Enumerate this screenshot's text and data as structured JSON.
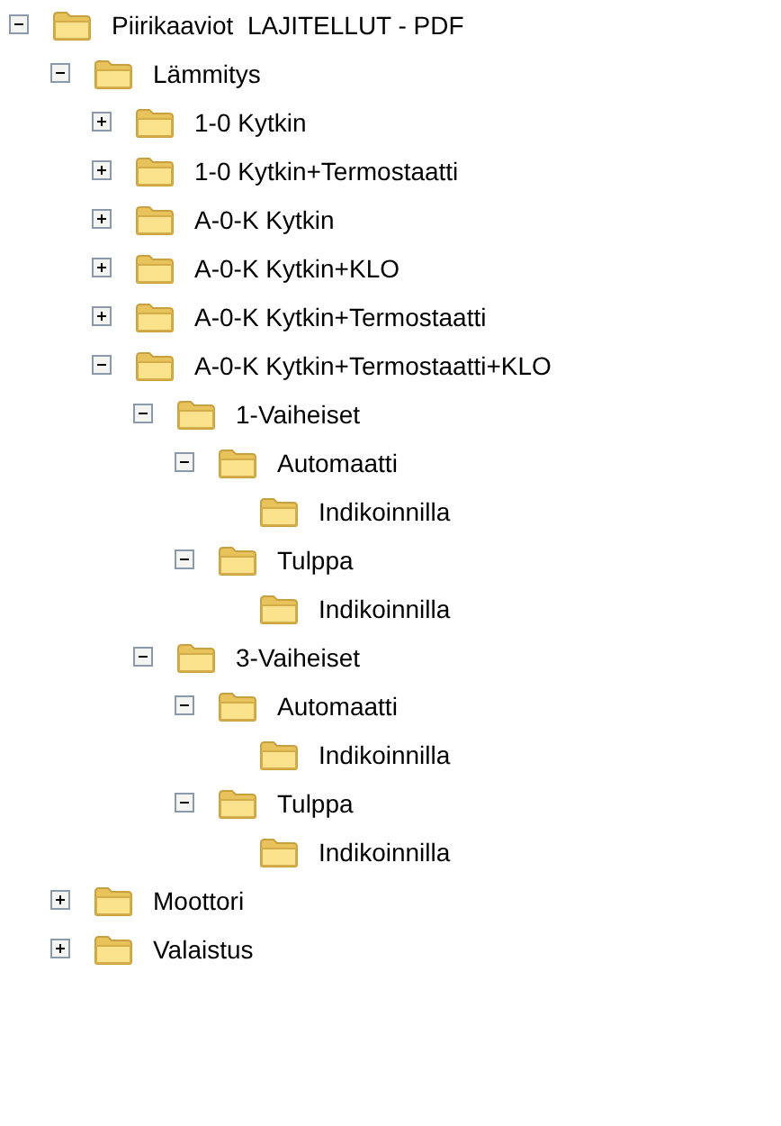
{
  "tree": [
    {
      "label": "Piirikaaviot  LAJITELLUT - PDF",
      "expanded": true,
      "children": [
        {
          "label": "Lämmitys",
          "expanded": true,
          "children": [
            {
              "label": "1-0 Kytkin",
              "expanded": false
            },
            {
              "label": "1-0 Kytkin+Termostaatti",
              "expanded": false
            },
            {
              "label": "A-0-K Kytkin",
              "expanded": false
            },
            {
              "label": "A-0-K Kytkin+KLO",
              "expanded": false
            },
            {
              "label": "A-0-K Kytkin+Termostaatti",
              "expanded": false
            },
            {
              "label": "A-0-K Kytkin+Termostaatti+KLO",
              "expanded": true,
              "children": [
                {
                  "label": "1-Vaiheiset",
                  "expanded": true,
                  "children": [
                    {
                      "label": "Automaatti",
                      "expanded": true,
                      "children": [
                        {
                          "label": "Indikoinnilla"
                        }
                      ]
                    },
                    {
                      "label": "Tulppa",
                      "expanded": true,
                      "children": [
                        {
                          "label": "Indikoinnilla"
                        }
                      ]
                    }
                  ]
                },
                {
                  "label": "3-Vaiheiset",
                  "expanded": true,
                  "children": [
                    {
                      "label": "Automaatti",
                      "expanded": true,
                      "children": [
                        {
                          "label": "Indikoinnilla"
                        }
                      ]
                    },
                    {
                      "label": "Tulppa",
                      "expanded": true,
                      "children": [
                        {
                          "label": "Indikoinnilla"
                        }
                      ]
                    }
                  ]
                }
              ]
            }
          ]
        },
        {
          "label": "Moottori",
          "expanded": false
        },
        {
          "label": "Valaistus",
          "expanded": false
        }
      ]
    }
  ]
}
